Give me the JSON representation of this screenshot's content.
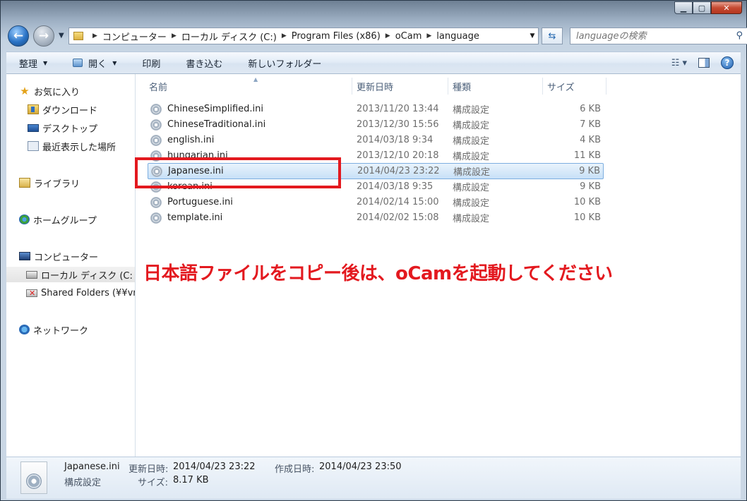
{
  "window": {
    "caption_buttons": [
      "minimize",
      "maximize",
      "close"
    ]
  },
  "address": {
    "crumbs": [
      "コンピューター",
      "ローカル ディスク (C:)",
      "Program Files (x86)",
      "oCam",
      "language"
    ]
  },
  "search": {
    "placeholder": "languageの検索"
  },
  "toolbar": {
    "organize": "整理",
    "open": "開く",
    "print": "印刷",
    "burn": "書き込む",
    "new_folder": "新しいフォルダー"
  },
  "nav": {
    "favorites": "お気に入り",
    "downloads": "ダウンロード",
    "desktop": "デスクトップ",
    "recent": "最近表示した場所",
    "libraries": "ライブラリ",
    "homegroup": "ホームグループ",
    "computer": "コンピューター",
    "local_disk": "ローカル ディスク (C:",
    "shared_folders": "Shared Folders (¥¥vr",
    "network": "ネットワーク"
  },
  "columns": {
    "name": "名前",
    "date": "更新日時",
    "type": "種類",
    "size": "サイズ"
  },
  "files": [
    {
      "name": "ChineseSimplified.ini",
      "date": "2013/11/20 13:44",
      "type": "構成設定",
      "size": "6 KB"
    },
    {
      "name": "ChineseTraditional.ini",
      "date": "2013/12/30 15:56",
      "type": "構成設定",
      "size": "7 KB"
    },
    {
      "name": "english.ini",
      "date": "2014/03/18 9:34",
      "type": "構成設定",
      "size": "4 KB"
    },
    {
      "name": "hungarian.ini",
      "date": "2013/12/10 20:18",
      "type": "構成設定",
      "size": "11 KB"
    },
    {
      "name": "Japanese.ini",
      "date": "2014/04/23 23:22",
      "type": "構成設定",
      "size": "9 KB"
    },
    {
      "name": "korean.ini",
      "date": "2014/03/18 9:35",
      "type": "構成設定",
      "size": "9 KB"
    },
    {
      "name": "Portuguese.ini",
      "date": "2014/02/14 15:00",
      "type": "構成設定",
      "size": "10 KB"
    },
    {
      "name": "template.ini",
      "date": "2014/02/02 15:08",
      "type": "構成設定",
      "size": "10 KB"
    }
  ],
  "selected_index": 4,
  "annotation": "日本語ファイルをコピー後は、oCamを起動してください",
  "details": {
    "name": "Japanese.ini",
    "type": "構成設定",
    "modified_label": "更新日時:",
    "modified": "2014/04/23 23:22",
    "created_label": "作成日時:",
    "created": "2014/04/23 23:50",
    "size_label": "サイズ:",
    "size": "8.17 KB"
  },
  "colors": {
    "annotation": "#e3191f",
    "selection": "#c7e0f7"
  }
}
